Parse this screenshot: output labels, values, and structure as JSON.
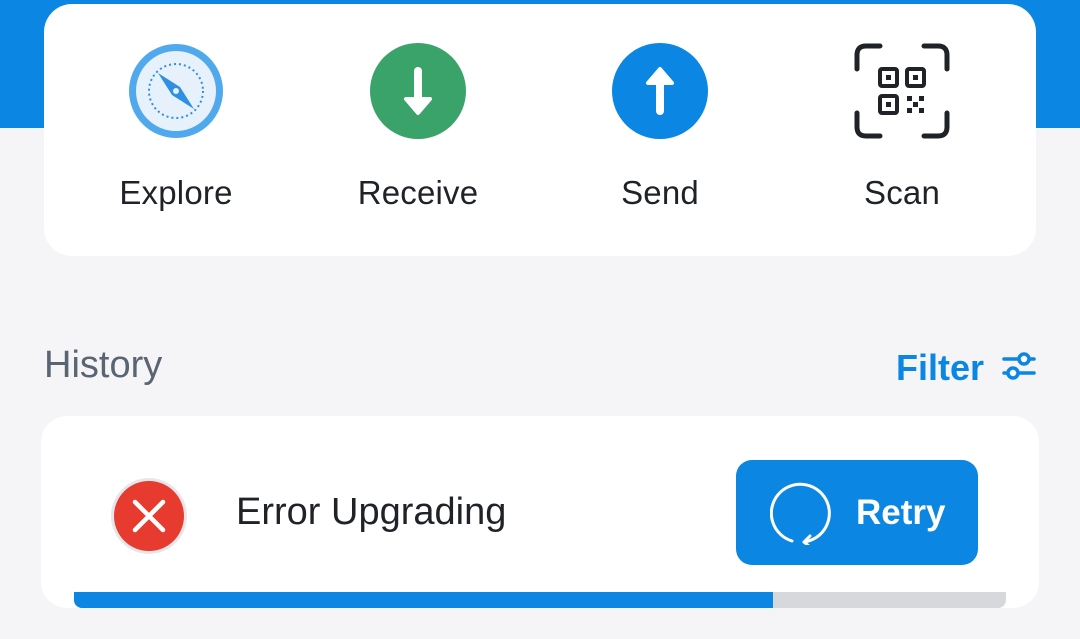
{
  "actions": [
    {
      "label": "Explore",
      "icon": "compass-icon"
    },
    {
      "label": "Receive",
      "icon": "arrow-down-icon"
    },
    {
      "label": "Send",
      "icon": "arrow-up-icon"
    },
    {
      "label": "Scan",
      "icon": "qr-scan-icon"
    }
  ],
  "history": {
    "title": "History",
    "filter_label": "Filter",
    "item": {
      "status_icon": "error-x-icon",
      "text": "Error Upgrading",
      "retry_label": "Retry",
      "progress_percent": 75
    }
  },
  "colors": {
    "accent": "#0b86e3",
    "receive_green": "#3aa36a",
    "error_red": "#e63b2e"
  }
}
